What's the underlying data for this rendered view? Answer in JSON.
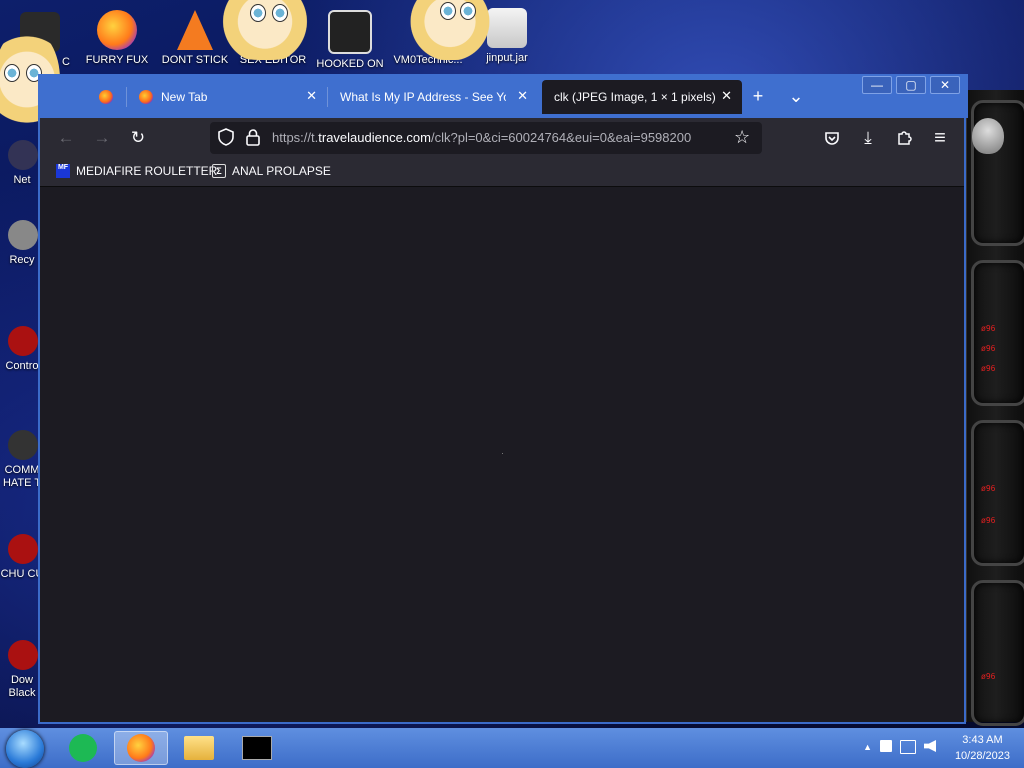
{
  "desktop": {
    "top_icons": [
      {
        "label": "C"
      },
      {
        "label": "FURRY FUX"
      },
      {
        "label": "DONT STICK"
      },
      {
        "label": "SEX EDITOR"
      },
      {
        "label": "HOOKED ON"
      },
      {
        "label": "VM0Technic..."
      },
      {
        "label": "jinput.jar"
      }
    ],
    "left_icons": [
      {
        "label": "Net"
      },
      {
        "label": "Recy"
      },
      {
        "label": "Contro"
      },
      {
        "label": "COMM HATE T"
      },
      {
        "label": "CHU CU"
      },
      {
        "label": "Dow Black"
      }
    ],
    "panel_readouts": [
      "ø96",
      "ø96",
      "ø96",
      "ø96",
      "ø96",
      "ø96"
    ]
  },
  "browser": {
    "tabs": [
      {
        "label": "",
        "pinned": true
      },
      {
        "label": "New Tab",
        "close": "✕"
      },
      {
        "label": "What Is My IP Address - See Your",
        "close": "✕"
      },
      {
        "label": "clk (JPEG Image, 1 × 1 pixels)",
        "close": "✕",
        "active": true
      }
    ],
    "new_tab_icon": "+",
    "tab_list_icon": "⌄",
    "window_controls": {
      "minimize": "—",
      "maximize": "▢",
      "close": "✕"
    },
    "nav": {
      "back_icon": "←",
      "forward_icon": "→",
      "reload_icon": "↻",
      "url_prefix": "https://t.",
      "url_domain": "travelaudience.com",
      "url_path": "/clk?pl=0&ci=60024764&eui=0&eai=9598200",
      "bookmark_star_icon": "☆",
      "pocket_icon": "pocket-icon",
      "download_icon": "⤓",
      "extensions_icon": "puzzle-icon",
      "menu_icon": "≡"
    },
    "bookmarks": [
      {
        "label": "MEDIAFIRE ROULETTER",
        "icon_text": "MF"
      },
      {
        "label": "ANAL PROLAPSE",
        "icon_text": "Σ"
      }
    ]
  },
  "taskbar": {
    "time": "3:43 AM",
    "date": "10/28/2023",
    "tray_arrow": "▲"
  }
}
